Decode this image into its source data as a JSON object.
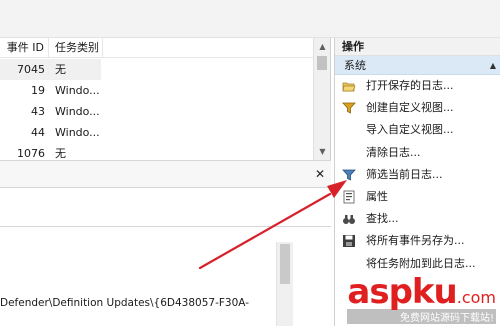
{
  "event_list": {
    "columns": {
      "event_id": "事件 ID",
      "task_category": "任务类别"
    },
    "rows": [
      {
        "event_id": "7045",
        "task_category": "无"
      },
      {
        "event_id": "19",
        "task_category": "Windo..."
      },
      {
        "event_id": "43",
        "task_category": "Windo..."
      },
      {
        "event_id": "44",
        "task_category": "Windo..."
      },
      {
        "event_id": "1076",
        "task_category": "无"
      }
    ]
  },
  "details": {
    "path_text": "Defender\\Definition Updates\\{6D438057-F30A-"
  },
  "actions_pane": {
    "title": "操作",
    "section": "系统",
    "items": [
      {
        "label": "打开保存的日志...",
        "icon": "folder-open-icon"
      },
      {
        "label": "创建自定义视图...",
        "icon": "filter-icon"
      },
      {
        "label": "导入自定义视图...",
        "icon": ""
      },
      {
        "label": "清除日志...",
        "icon": ""
      },
      {
        "label": "筛选当前日志...",
        "icon": "filter-icon"
      },
      {
        "label": "属性",
        "icon": "properties-icon"
      },
      {
        "label": "查找...",
        "icon": "binoculars-icon"
      },
      {
        "label": "将所有事件另存为...",
        "icon": "save-icon"
      },
      {
        "label": "将任务附加到此日志...",
        "icon": ""
      }
    ]
  },
  "watermark": {
    "main": "aspku",
    "suffix": ".com",
    "sub": "免费网站源码下载站!"
  },
  "colors": {
    "section_bg": "#dbe9f7",
    "arrow": "#d6212b"
  }
}
